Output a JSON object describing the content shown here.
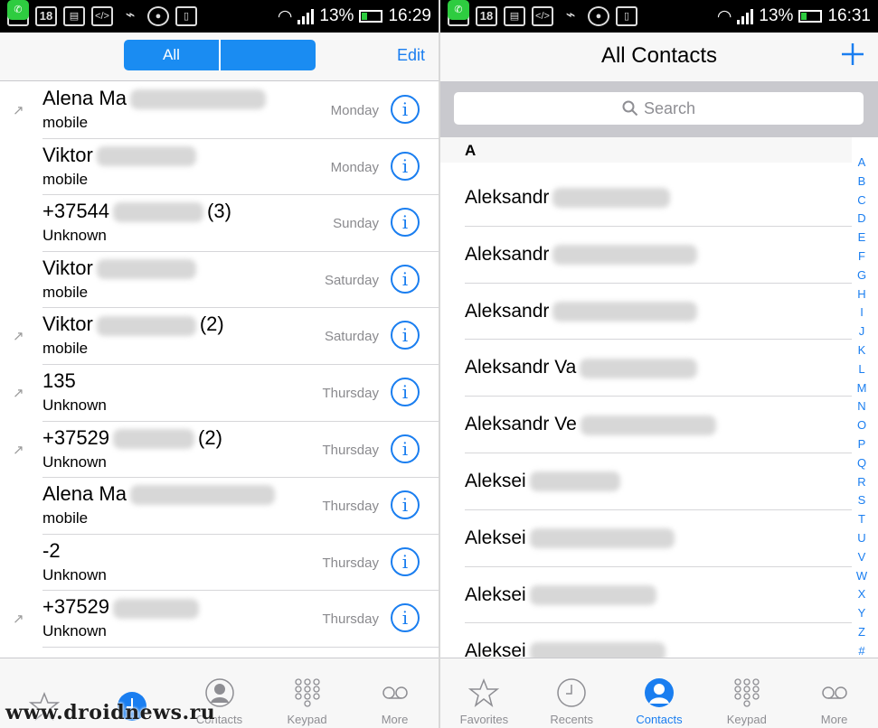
{
  "status_left": {
    "time": "16:29",
    "battery": "13%",
    "calendar_day": "18"
  },
  "status_right": {
    "time": "16:31",
    "battery": "13%",
    "calendar_day": "18"
  },
  "recents": {
    "segment": {
      "all_label": "All",
      "missed_label": ""
    },
    "edit_label": "Edit",
    "rows": [
      {
        "name": "Alena Ma",
        "count": "",
        "type": "mobile",
        "day": "Monday",
        "outgoing": true
      },
      {
        "name": "Viktor",
        "count": "",
        "type": "mobile",
        "day": "Monday",
        "outgoing": false
      },
      {
        "name": "+37544",
        "count": "(3)",
        "type": "Unknown",
        "day": "Sunday",
        "outgoing": false
      },
      {
        "name": "Viktor",
        "count": "",
        "type": "mobile",
        "day": "Saturday",
        "outgoing": false
      },
      {
        "name": "Viktor",
        "count": "(2)",
        "type": "mobile",
        "day": "Saturday",
        "outgoing": true
      },
      {
        "name": "135",
        "count": "",
        "type": "Unknown",
        "day": "Thursday",
        "outgoing": true
      },
      {
        "name": "+37529",
        "count": "(2)",
        "type": "Unknown",
        "day": "Thursday",
        "outgoing": true
      },
      {
        "name": "Alena Ma",
        "count": "",
        "type": "mobile",
        "day": "Thursday",
        "outgoing": false
      },
      {
        "name": "-2",
        "count": "",
        "type": "Unknown",
        "day": "Thursday",
        "outgoing": false
      },
      {
        "name": "+37529",
        "count": "",
        "type": "Unknown",
        "day": "Thursday",
        "outgoing": true
      }
    ]
  },
  "contacts": {
    "title": "All Contacts",
    "search_placeholder": "Search",
    "section": "A",
    "rows": [
      {
        "name": "Aleksandr"
      },
      {
        "name": "Aleksandr"
      },
      {
        "name": "Aleksandr"
      },
      {
        "name": "Aleksandr Va"
      },
      {
        "name": "Aleksandr Ve"
      },
      {
        "name": "Aleksei"
      },
      {
        "name": "Aleksei"
      },
      {
        "name": "Aleksei"
      },
      {
        "name": "Aleksei"
      }
    ],
    "index": [
      "A",
      "B",
      "C",
      "D",
      "E",
      "F",
      "G",
      "H",
      "I",
      "J",
      "K",
      "L",
      "M",
      "N",
      "O",
      "P",
      "Q",
      "R",
      "S",
      "T",
      "U",
      "V",
      "W",
      "X",
      "Y",
      "Z",
      "#"
    ]
  },
  "tabbar_left": {
    "active": "recents",
    "tabs": [
      {
        "id": "favorites",
        "label": "",
        "icon": "star-icon"
      },
      {
        "id": "recents",
        "label": "",
        "icon": "clock-icon"
      },
      {
        "id": "contacts",
        "label": "Contacts",
        "icon": "person-icon"
      },
      {
        "id": "keypad",
        "label": "Keypad",
        "icon": "keypad-icon"
      },
      {
        "id": "more",
        "label": "More",
        "icon": "voicemail-icon"
      }
    ]
  },
  "tabbar_right": {
    "active": "contacts",
    "tabs": [
      {
        "id": "favorites",
        "label": "Favorites",
        "icon": "star-icon"
      },
      {
        "id": "recents",
        "label": "Recents",
        "icon": "clock-icon"
      },
      {
        "id": "contacts",
        "label": "Contacts",
        "icon": "person-icon"
      },
      {
        "id": "keypad",
        "label": "Keypad",
        "icon": "keypad-icon"
      },
      {
        "id": "more",
        "label": "More",
        "icon": "voicemail-icon"
      }
    ]
  },
  "watermark": "www.droidnews.ru",
  "colors": {
    "accent": "#1a7ef0",
    "segment": "#1a8cf2",
    "status_bar": "#000000",
    "battery_green": "#2ecc40"
  }
}
